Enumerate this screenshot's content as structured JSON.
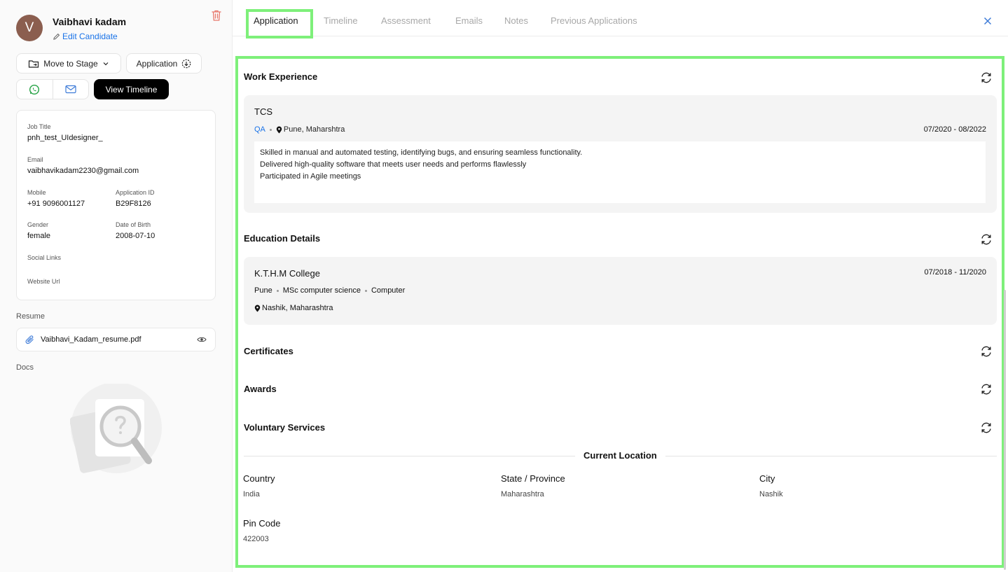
{
  "candidate": {
    "initial": "V",
    "name": "Vaibhavi kadam",
    "edit_label": "Edit Candidate"
  },
  "actions": {
    "move_stage": "Move to Stage",
    "application": "Application",
    "view_timeline": "View Timeline"
  },
  "info": {
    "job_title_label": "Job Title",
    "job_title": "pnh_test_UIdesigner_",
    "email_label": "Email",
    "email": "vaibhavikadam2230@gmail.com",
    "mobile_label": "Mobile",
    "mobile": "+91 9096001127",
    "app_id_label": "Application ID",
    "app_id": "B29F8126",
    "gender_label": "Gender",
    "gender": "female",
    "dob_label": "Date of Birth",
    "dob": "2008-07-10",
    "social_label": "Social Links",
    "website_label": "Website Url"
  },
  "resume": {
    "label": "Resume",
    "file": "Vaibhavi_Kadam_resume.pdf"
  },
  "docs": {
    "label": "Docs"
  },
  "tabs": [
    "Application",
    "Timeline",
    "Assessment",
    "Emails",
    "Notes",
    "Previous Applications"
  ],
  "work": {
    "title": "Work Experience",
    "company": "TCS",
    "role": "QA",
    "location": "Pune, Maharshtra",
    "dates": "07/2020 - 08/2022",
    "lines": [
      "Skilled in manual and automated testing, identifying bugs, and ensuring seamless functionality.",
      "Delivered high-quality software that meets user needs and performs flawlessly",
      "Participated in Agile meetings"
    ]
  },
  "education": {
    "title": "Education Details",
    "college": "K.T.H.M College",
    "dates": "07/2018 - 11/2020",
    "city": "Pune",
    "degree": "MSc computer science",
    "field": "Computer",
    "location": "Nashik, Maharashtra"
  },
  "certificates": {
    "title": "Certificates"
  },
  "awards": {
    "title": "Awards"
  },
  "voluntary": {
    "title": "Voluntary Services"
  },
  "current_location": {
    "title": "Current Location",
    "country_label": "Country",
    "country": "India",
    "state_label": "State / Province",
    "state": "Maharashtra",
    "city_label": "City",
    "city": "Nashik",
    "pin_label": "Pin Code",
    "pin": "422003"
  },
  "colors": {
    "accent_link": "#1a73e8",
    "highlight": "#7ef07a",
    "trash": "#e8776b",
    "whatsapp": "#25a244"
  }
}
